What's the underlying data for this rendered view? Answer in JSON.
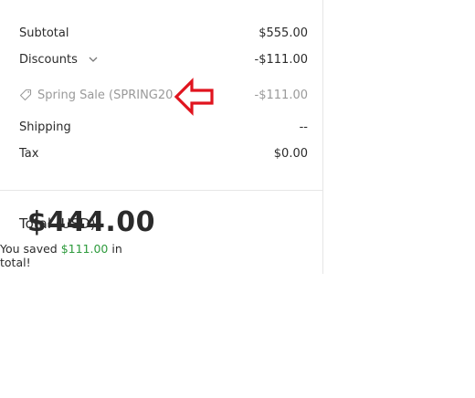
{
  "summary": {
    "subtotal": {
      "label": "Subtotal",
      "value": "$555.00"
    },
    "discounts": {
      "label": "Discounts",
      "value": "-$111.00"
    },
    "discount_item": {
      "label": "Spring Sale (SPRING20",
      "value": "-$111.00"
    },
    "shipping": {
      "label": "Shipping",
      "value": "--"
    },
    "tax": {
      "label": "Tax",
      "value": "$0.00"
    }
  },
  "total": {
    "label": "Total (USD)",
    "value": "$444.00",
    "saved_prefix": "You saved ",
    "saved_amount": "$111.00",
    "saved_suffix": " in total!"
  },
  "icons": {
    "discount_toggle": "chevron-down-icon",
    "discount_tag": "tag-icon",
    "annotation": "left-arrow-icon"
  },
  "colors": {
    "saved_amount": "#2e9b3d",
    "annotation_arrow": "#e0141e"
  }
}
